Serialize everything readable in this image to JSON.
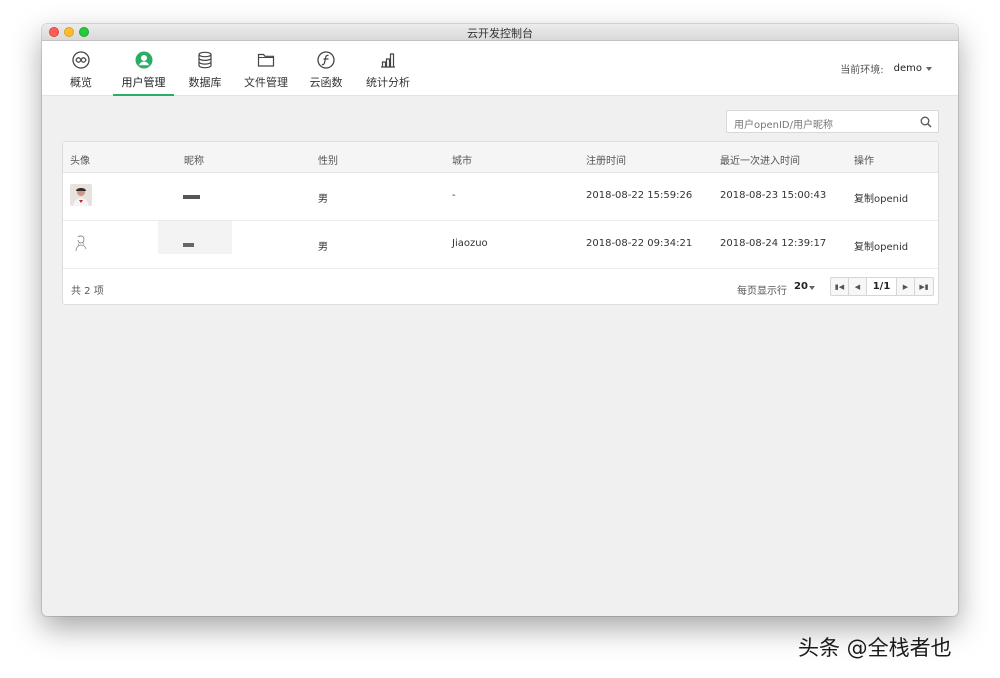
{
  "window": {
    "title": "云开发控制台"
  },
  "nav": {
    "items": [
      {
        "label": "概览",
        "icon": "overview-icon"
      },
      {
        "label": "用户管理",
        "icon": "user-icon",
        "active": true
      },
      {
        "label": "数据库",
        "icon": "database-icon"
      },
      {
        "label": "文件管理",
        "icon": "folder-icon"
      },
      {
        "label": "云函数",
        "icon": "cloud-function-icon"
      },
      {
        "label": "统计分析",
        "icon": "statistics-icon"
      }
    ],
    "env_label": "当前环境:",
    "env_value": "demo"
  },
  "search": {
    "placeholder": "用户openID/用户昵称"
  },
  "table": {
    "headers": [
      "头像",
      "昵称",
      "性别",
      "城市",
      "注册时间",
      "最近一次进入时间",
      "操作"
    ],
    "rows": [
      {
        "gender": "男",
        "city": "-",
        "registered": "2018-08-22 15:59:26",
        "last_visit": "2018-08-23 15:00:43",
        "action": "复制openid"
      },
      {
        "gender": "男",
        "city": "Jiaozuo",
        "registered": "2018-08-22 09:34:21",
        "last_visit": "2018-08-24 12:39:17",
        "action": "复制openid"
      }
    ]
  },
  "footer": {
    "total": "共 2 项",
    "per_page_label": "每页显示行",
    "per_page_value": "20",
    "page_info": "1/1"
  },
  "watermark": "头条 @全栈者也",
  "colors": {
    "accent": "#2aae67",
    "window_bg": "#f0f0f0"
  }
}
